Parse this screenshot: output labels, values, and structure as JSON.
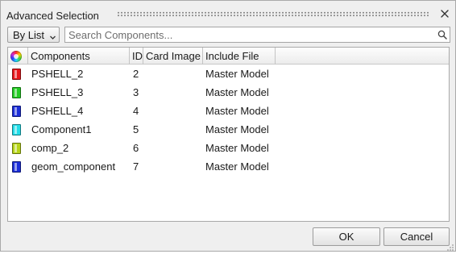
{
  "window": {
    "title": "Advanced Selection"
  },
  "toolbar": {
    "mode_label": "By List",
    "search_placeholder": "Search Components..."
  },
  "table": {
    "columns": {
      "color": "",
      "components": "Components",
      "id": "ID",
      "card_image": "Card Image",
      "include_file": "Include File"
    },
    "rows": [
      {
        "color": "#e8161b",
        "name": "PSHELL_2",
        "id": "2",
        "card_image": "",
        "include_file": "Master Model"
      },
      {
        "color": "#22cc22",
        "name": "PSHELL_3",
        "id": "3",
        "card_image": "",
        "include_file": "Master Model"
      },
      {
        "color": "#1c2ed8",
        "name": "PSHELL_4",
        "id": "4",
        "card_image": "",
        "include_file": "Master Model"
      },
      {
        "color": "#22dde8",
        "name": "Component1",
        "id": "5",
        "card_image": "",
        "include_file": "Master Model"
      },
      {
        "color": "#b6d418",
        "name": "comp_2",
        "id": "6",
        "card_image": "",
        "include_file": "Master Model"
      },
      {
        "color": "#1c2ed8",
        "name": "geom_component",
        "id": "7",
        "card_image": "",
        "include_file": "Master Model"
      }
    ]
  },
  "buttons": {
    "ok": "OK",
    "cancel": "Cancel"
  }
}
